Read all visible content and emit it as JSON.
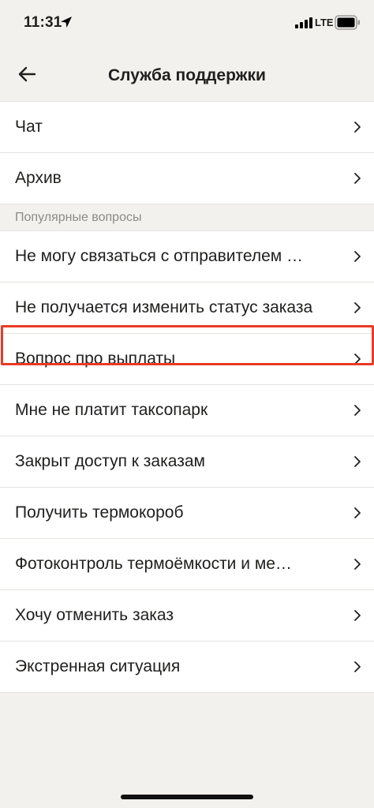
{
  "status_bar": {
    "time": "11:31",
    "network": "LTE",
    "icons": [
      "location-arrow-icon",
      "signal-icon",
      "battery-icon"
    ]
  },
  "header": {
    "title": "Служба поддержки",
    "back_icon": "arrow-left-icon"
  },
  "menu": {
    "items": [
      {
        "label": "Чат"
      },
      {
        "label": "Архив"
      }
    ]
  },
  "popular": {
    "header": "Популярные вопросы",
    "items": [
      {
        "label": "Не могу связаться с отправителем …"
      },
      {
        "label": "Не получается изменить статус заказа"
      },
      {
        "label": "Вопрос про выплаты",
        "highlighted": true
      },
      {
        "label": "Мне не платит таксопарк"
      },
      {
        "label": "Закрыт доступ к заказам"
      },
      {
        "label": "Получить термокороб"
      },
      {
        "label": "Фотоконтроль термоёмкости и ме…"
      },
      {
        "label": "Хочу отменить заказ"
      },
      {
        "label": "Экстренная ситуация"
      }
    ]
  },
  "colors": {
    "background": "#f2f1ee",
    "row_background": "#ffffff",
    "highlight": "#ea3b24",
    "text": "#21201f",
    "muted_text": "#8c8b88"
  }
}
